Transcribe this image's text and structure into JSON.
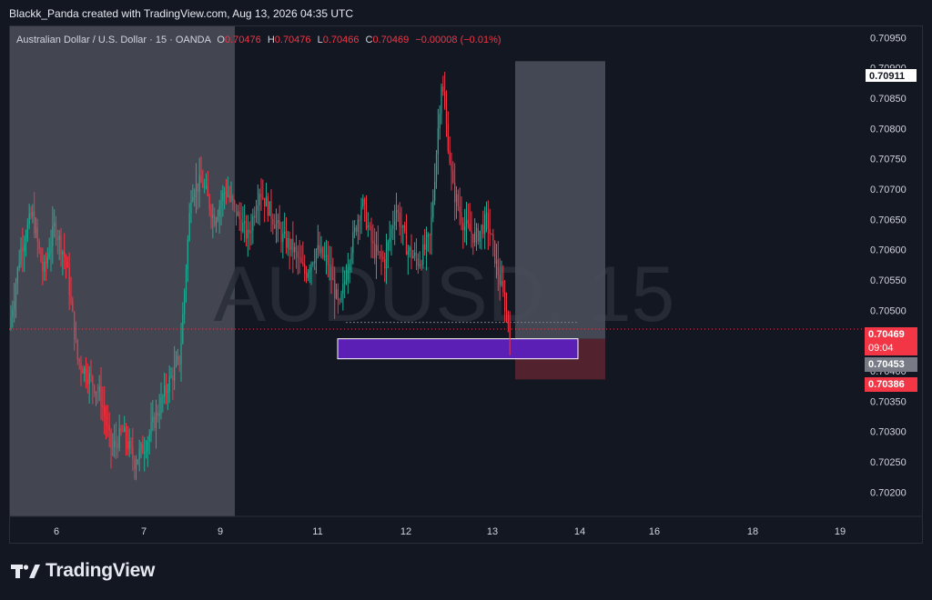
{
  "header": {
    "credit": "Blackk_Panda created with TradingView.com, Aug 13, 2026 04:35 UTC"
  },
  "legend": {
    "symbol": "Australian Dollar / U.S. Dollar · 15 · OANDA",
    "open_key": "O",
    "open": "0.70476",
    "high_key": "H",
    "high": "0.70476",
    "low_key": "L",
    "low": "0.70466",
    "close_key": "C",
    "close": "0.70469",
    "change": "−0.00008 (−0.01%)"
  },
  "watermark": "AUDUSD, 15",
  "price_tags": {
    "target": "0.70911",
    "last": "0.70469",
    "countdown": "09:04",
    "entry": "0.70453",
    "stop": "0.70386"
  },
  "footer": {
    "brand": "TradingView"
  },
  "colors": {
    "background": "#131722",
    "bull": "#22ab94",
    "bear": "#f23645",
    "session_shade": "#434651",
    "zone": "#5b1fb5",
    "profit_zone": "#4a4e5a",
    "loss_zone": "#5a2530"
  },
  "chart_data": {
    "type": "candlestick",
    "y_ticks": [
      "0.70950",
      "0.70900",
      "0.70850",
      "0.70800",
      "0.70750",
      "0.70700",
      "0.70650",
      "0.70600",
      "0.70550",
      "0.70500",
      "0.70450",
      "0.70400",
      "0.70350",
      "0.70300",
      "0.70250",
      "0.70200"
    ],
    "ylim": [
      0.7016,
      0.7097
    ],
    "x_ticks": [
      {
        "label": "6",
        "pos": 0.0
      },
      {
        "label": "7",
        "pos": 0.1
      },
      {
        "label": "9",
        "pos": 0.2
      },
      {
        "label": "11",
        "pos": 0.3
      },
      {
        "label": "12",
        "pos": 0.4
      },
      {
        "label": "13",
        "pos": 0.5
      },
      {
        "label": "14",
        "pos": 0.6
      },
      {
        "label": "16",
        "pos": 0.7
      },
      {
        "label": "18",
        "pos": 0.8
      },
      {
        "label": "19",
        "pos": 0.9
      }
    ],
    "price_path": [
      [
        0,
        0.7047
      ],
      [
        1,
        0.706
      ],
      [
        2,
        0.7066
      ],
      [
        3,
        0.7056
      ],
      [
        4,
        0.7064
      ],
      [
        5,
        0.7058
      ],
      [
        6,
        0.7042
      ],
      [
        7,
        0.7039
      ],
      [
        8,
        0.7036
      ],
      [
        9,
        0.7027
      ],
      [
        10,
        0.703
      ],
      [
        11,
        0.7025
      ],
      [
        12,
        0.7028
      ],
      [
        13,
        0.7033
      ],
      [
        14,
        0.7038
      ],
      [
        15,
        0.7042
      ],
      [
        16,
        0.707
      ],
      [
        17,
        0.7071
      ],
      [
        18,
        0.7065
      ],
      [
        19,
        0.707
      ],
      [
        20,
        0.7066
      ],
      [
        21,
        0.7062
      ],
      [
        22,
        0.707
      ],
      [
        23,
        0.7066
      ],
      [
        24,
        0.7062
      ],
      [
        25,
        0.706
      ],
      [
        26,
        0.7056
      ],
      [
        27,
        0.706
      ],
      [
        28,
        0.7058
      ],
      [
        29,
        0.705
      ],
      [
        30,
        0.706
      ],
      [
        31,
        0.7068
      ],
      [
        32,
        0.706
      ],
      [
        33,
        0.7058
      ],
      [
        34,
        0.7067
      ],
      [
        35,
        0.706
      ],
      [
        36,
        0.7058
      ],
      [
        37,
        0.7062
      ],
      [
        38,
        0.7088
      ],
      [
        39,
        0.707
      ],
      [
        40,
        0.7064
      ],
      [
        41,
        0.7062
      ],
      [
        42,
        0.7065
      ],
      [
        43,
        0.7056
      ],
      [
        44,
        0.70469
      ]
    ],
    "sessions_shaded": [
      [
        0,
        0.25
      ]
    ],
    "demand_zone": {
      "from": 0.361,
      "to": 0.621,
      "low": 0.7042,
      "high": 0.70453
    },
    "position": {
      "from": 0.551,
      "to": 0.655,
      "entry": 0.70453,
      "target": 0.70911,
      "stop": 0.70386
    },
    "last_price": 0.70469
  }
}
